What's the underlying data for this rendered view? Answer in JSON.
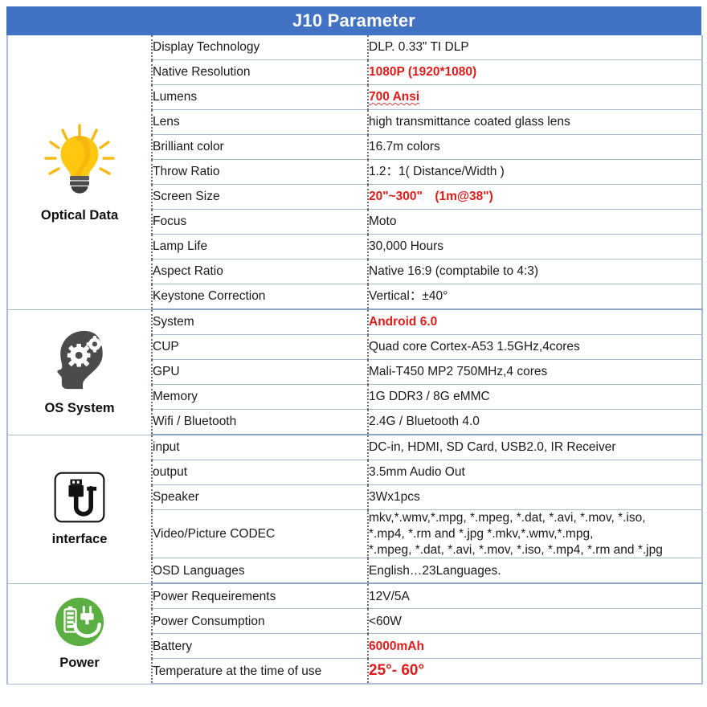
{
  "header": {
    "title": "J10 Parameter",
    "bg_color": "#4272C4",
    "text_color": "#FFFFFF"
  },
  "accent_colors": {
    "highlight_red": "#E01B1B",
    "grid_line": "#A9BDD6",
    "divider_dotted": "#6F6F6F"
  },
  "sections": [
    {
      "label": "Optical Data",
      "icon": "lightbulb-icon",
      "rows": [
        {
          "key": "Display Technology",
          "value": "DLP. 0.33\"    TI DLP",
          "style": "plain"
        },
        {
          "key": "Native Resolution",
          "value": "1080P (1920*1080)",
          "style": "red"
        },
        {
          "key": "Lumens",
          "value": "700 Ansi",
          "style": "red"
        },
        {
          "key": "Lens",
          "value": "high transmittance coated glass lens",
          "style": "plain"
        },
        {
          "key": "Brilliant color",
          "value": "16.7m colors",
          "style": "plain"
        },
        {
          "key": "Throw Ratio",
          "value": "1.2：1( Distance/Width )",
          "style": "plain"
        },
        {
          "key": "Screen Size",
          "value": "20\"~300\"　(1m@38\")",
          "style": "red"
        },
        {
          "key": "Focus",
          "value": "Moto",
          "style": "plain"
        },
        {
          "key": "Lamp Life",
          "value": "30,000 Hours",
          "style": "plain"
        },
        {
          "key": "Aspect Ratio",
          "value": "Native 16:9 (comptabile to 4:3)",
          "style": "plain"
        },
        {
          "key": "Keystone Correction",
          "value": "Vertical：±40°",
          "style": "plain"
        }
      ]
    },
    {
      "label": "OS System",
      "icon": "head-gears-icon",
      "rows": [
        {
          "key": "System",
          "value": "Android 6.0",
          "style": "red"
        },
        {
          "key": "CUP",
          "value": "Quad core Cortex-A53  1.5GHz,4cores",
          "style": "plain"
        },
        {
          "key": "GPU",
          "value": "Mali-T450 MP2 750MHz,4 cores",
          "style": "plain"
        },
        {
          "key": "Memory",
          "value": "1G DDR3 / 8G eMMC",
          "style": "plain"
        },
        {
          "key": "Wifi / Bluetooth",
          "value": "2.4G / Bluetooth 4.0",
          "style": "plain"
        }
      ]
    },
    {
      "label": "interface",
      "icon": "usb-connector-icon",
      "rows": [
        {
          "key": "input",
          "value": "DC-in, HDMI, SD Card, USB2.0, IR Receiver",
          "style": "plain"
        },
        {
          "key": "output",
          "value": "3.5mm Audio Out",
          "style": "plain"
        },
        {
          "key": "Speaker",
          "value": "3Wx1pcs",
          "style": "plain"
        },
        {
          "key": "Video/Picture CODEC",
          "value": "mkv,*.wmv,*.mpg, *.mpeg, *.dat, *.avi, *.mov, *.iso,\n*.mp4, *.rm and *.jpg        *.mkv,*.wmv,*.mpg,\n*.mpeg, *.dat, *.avi, *.mov, *.iso, *.mp4, *.rm and *.jpg",
          "style": "codec"
        },
        {
          "key": "OSD  Languages",
          "value": "English…23Languages.",
          "style": "plain"
        }
      ]
    },
    {
      "label": "Power",
      "icon": "power-plug-battery-icon",
      "rows": [
        {
          "key": "Power Requeirements",
          "value": "12V/5A",
          "style": "plain"
        },
        {
          "key": "Power Consumption",
          "value": "<60W",
          "style": "plain"
        },
        {
          "key": "Battery",
          "value": "6000mAh",
          "style": "red"
        },
        {
          "key": "Temperature at the time of use",
          "value": "25°- 60°",
          "style": "red-deg"
        }
      ]
    }
  ]
}
